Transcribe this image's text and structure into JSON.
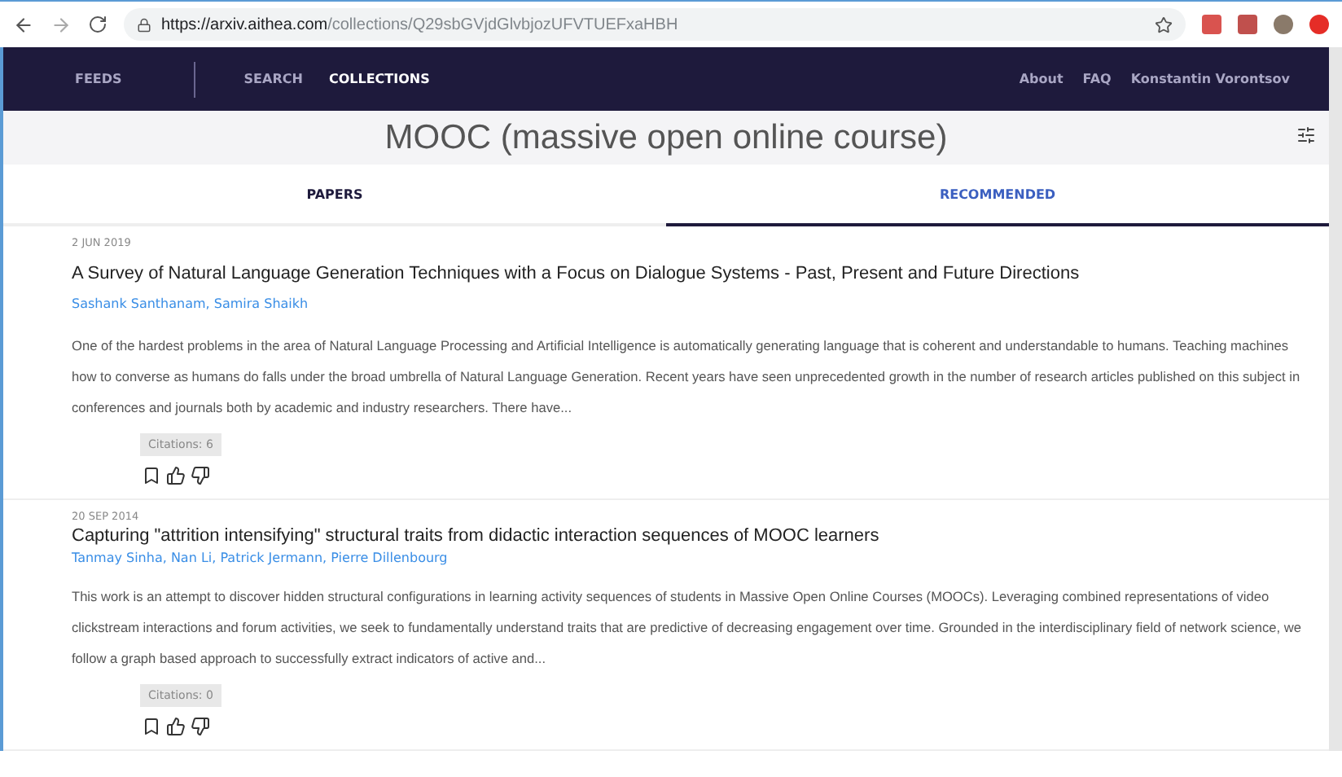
{
  "browser": {
    "url_host": "https://arxiv.aithea.com",
    "url_path": "/collections/Q29sbGVjdGlvbjozUFVTUEFxaHBH"
  },
  "nav": {
    "left": [
      {
        "label": "FEEDS",
        "selected": false
      },
      {
        "label": "SEARCH",
        "selected": false
      },
      {
        "label": "COLLECTIONS",
        "selected": true
      }
    ],
    "right": [
      "About",
      "FAQ",
      "Konstantin Vorontsov"
    ]
  },
  "collection": {
    "title": "MOOC (massive open online course)"
  },
  "tabs": [
    {
      "label": "PAPERS",
      "selected": false
    },
    {
      "label": "RECOMMENDED",
      "selected": true
    }
  ],
  "papers": [
    {
      "date": "2 JUN 2019",
      "title": "A Survey of Natural Language Generation Techniques with a Focus on Dialogue Systems - Past, Present and Future Directions",
      "authors": "Sashank Santhanam, Samira Shaikh",
      "abstract": "One of the hardest problems in the area of Natural Language Processing and Artificial Intelligence is automatically generating language that is coherent and understandable to humans. Teaching machines how to converse as humans do falls under the broad umbrella of Natural Language Generation. Recent years have seen unprecedented growth in the number of research articles published on this subject in conferences and journals both by academic and industry researchers. There have...",
      "citations": "Citations: 6"
    },
    {
      "date": "20 SEP 2014",
      "title": "Capturing \"attrition intensifying\" structural traits from didactic interaction sequences of MOOC learners",
      "authors": "Tanmay Sinha, Nan Li, Patrick Jermann, Pierre Dillenbourg",
      "abstract": "This work is an attempt to discover hidden structural configurations in learning activity sequences of students in Massive Open Online Courses (MOOCs). Leveraging combined representations of video clickstream interactions and forum activities, we seek to fundamentally understand traits that are predictive of decreasing engagement over time. Grounded in the interdisciplinary field of network science, we follow a graph based approach to successfully extract indicators of active and...",
      "citations": "Citations: 0"
    }
  ]
}
